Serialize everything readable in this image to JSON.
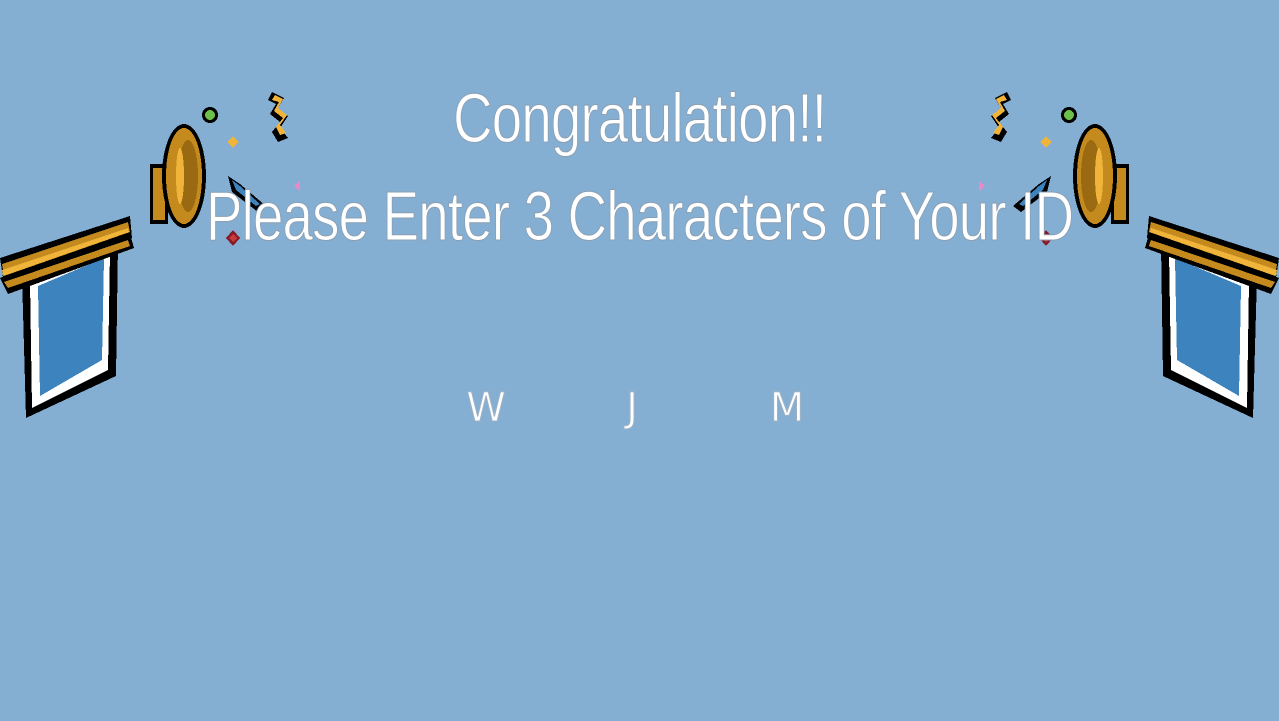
{
  "screen": {
    "title": "Congratulation!!",
    "subtitle": "Please Enter 3 Characters of Your ID"
  },
  "id_entry": {
    "characters": [
      "W",
      "J",
      "M"
    ]
  },
  "decorations": {
    "left": "trumpet-with-banner-and-confetti",
    "right": "trumpet-with-banner-and-confetti"
  },
  "colors": {
    "background": "#84afd3",
    "text": "#ffffff",
    "trumpet_gold": "#c48a1e",
    "banner_blue": "#3d83bd"
  }
}
